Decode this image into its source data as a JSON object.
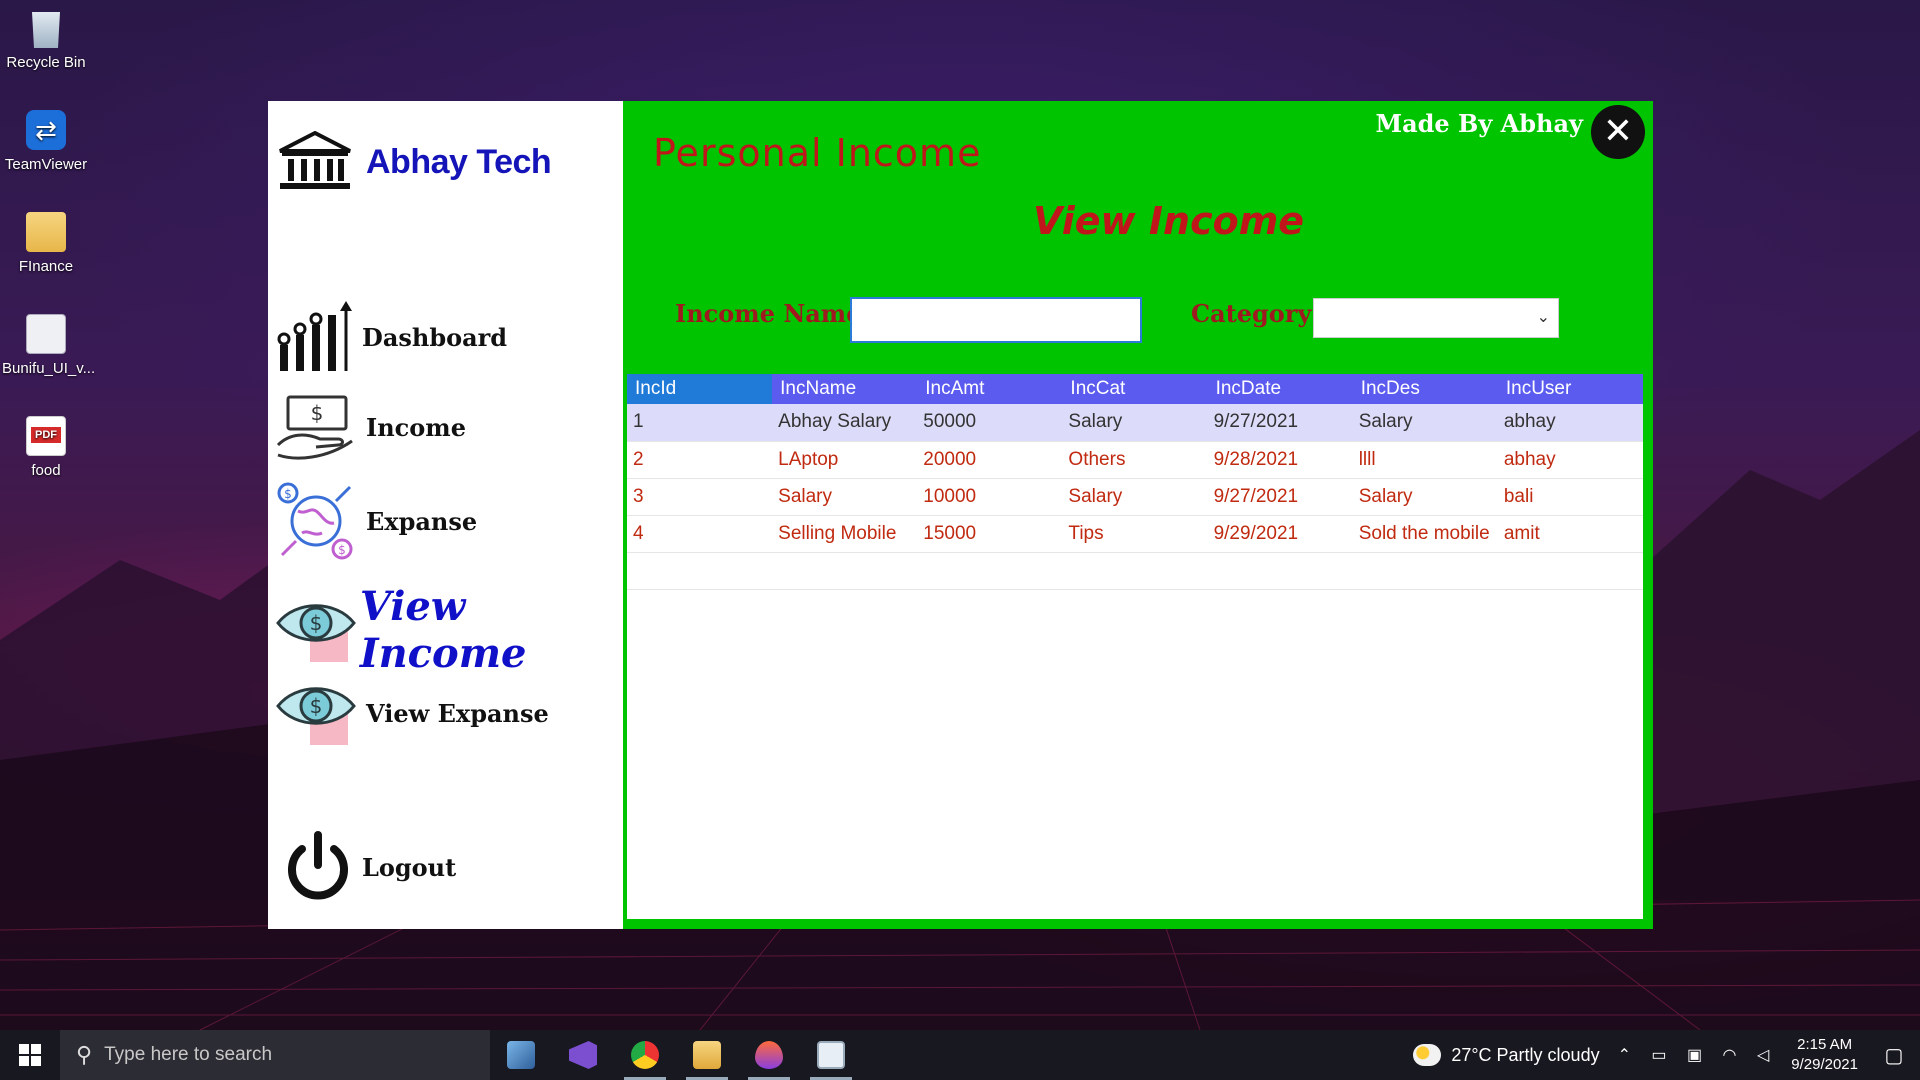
{
  "desktop": {
    "icons": [
      {
        "label": "Recycle Bin",
        "icon": "recycle-bin-icon"
      },
      {
        "label": "TeamViewer",
        "icon": "teamviewer-icon"
      },
      {
        "label": "FInance",
        "icon": "folder-icon"
      },
      {
        "label": "Bunifu_UI_v...",
        "icon": "dll-file-icon"
      },
      {
        "label": "food",
        "icon": "pdf-file-icon"
      }
    ]
  },
  "app": {
    "brand": "Abhay Tech",
    "made_by": "Made By Abhay",
    "close_glyph": "✕",
    "title": "Personal Income",
    "page_title": "View Income",
    "colors": {
      "accent_green": "#00c400",
      "sidebar_bg": "#ffffff",
      "title_red": "#c0161b",
      "active_nav": "#1010c8",
      "grid_header": "#5b5bf0"
    },
    "nav": [
      {
        "label": "Dashboard",
        "icon": "dashboard-chart-icon",
        "active": false
      },
      {
        "label": "Income",
        "icon": "money-hand-icon",
        "active": false
      },
      {
        "label": "Expanse",
        "icon": "globe-dollar-icon",
        "active": false
      },
      {
        "label": "View Income",
        "icon": "eye-dollar-icon",
        "active": true
      },
      {
        "label": "View Expanse",
        "icon": "eye-dollar-icon",
        "active": false
      },
      {
        "label": "Logout",
        "icon": "power-icon",
        "active": false
      }
    ],
    "filters": {
      "income_name_label": "Income Name",
      "income_name_value": "",
      "category_label": "Category",
      "category_value": ""
    },
    "grid": {
      "columns": [
        "IncId",
        "IncName",
        "IncAmt",
        "IncCat",
        "IncDate",
        "IncDes",
        "IncUser"
      ],
      "rows": [
        [
          "1",
          "Abhay Salary",
          "50000",
          "Salary",
          "9/27/2021",
          "Salary",
          "abhay"
        ],
        [
          "2",
          "LAptop",
          "20000",
          "Others",
          "9/28/2021",
          "llll",
          "abhay"
        ],
        [
          "3",
          "Salary",
          "10000",
          "Salary",
          "9/27/2021",
          "Salary",
          "bali"
        ],
        [
          "4",
          "Selling Mobile",
          "15000",
          "Tips",
          "9/29/2021",
          "Sold the mobile",
          "amit"
        ]
      ],
      "selected_row": 0
    }
  },
  "taskbar": {
    "search_placeholder": "Type here to search",
    "apps": [
      "file-explorer-laptop-icon",
      "visual-studio-icon",
      "chrome-icon",
      "folder-icon",
      "flame-app-icon",
      "window-app-icon"
    ],
    "weather": "27°C  Partly cloudy",
    "time": "2:15 AM",
    "date": "9/29/2021"
  }
}
